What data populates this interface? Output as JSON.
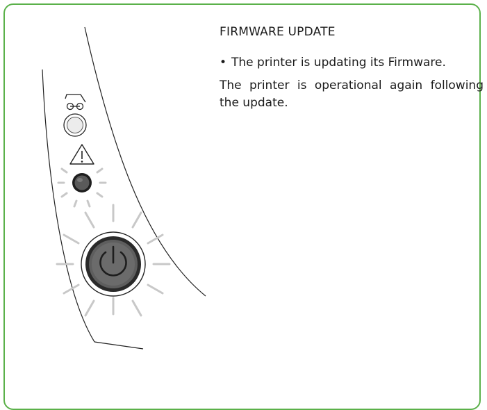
{
  "heading": "FIRMWARE UPDATE",
  "bullet_marker": "•",
  "bullets": [
    "The printer is updating its Firmware."
  ],
  "paragraph": "The printer is operational again following the update.",
  "colors": {
    "frame_border": "#5bb14a",
    "led_off": "#dddddd",
    "led_on": "#555555",
    "glow_rays": "#c8c8c8"
  },
  "icons": {
    "top_button": "ribbon-icon",
    "middle_button": "warning-icon",
    "bottom_button": "power-icon"
  }
}
